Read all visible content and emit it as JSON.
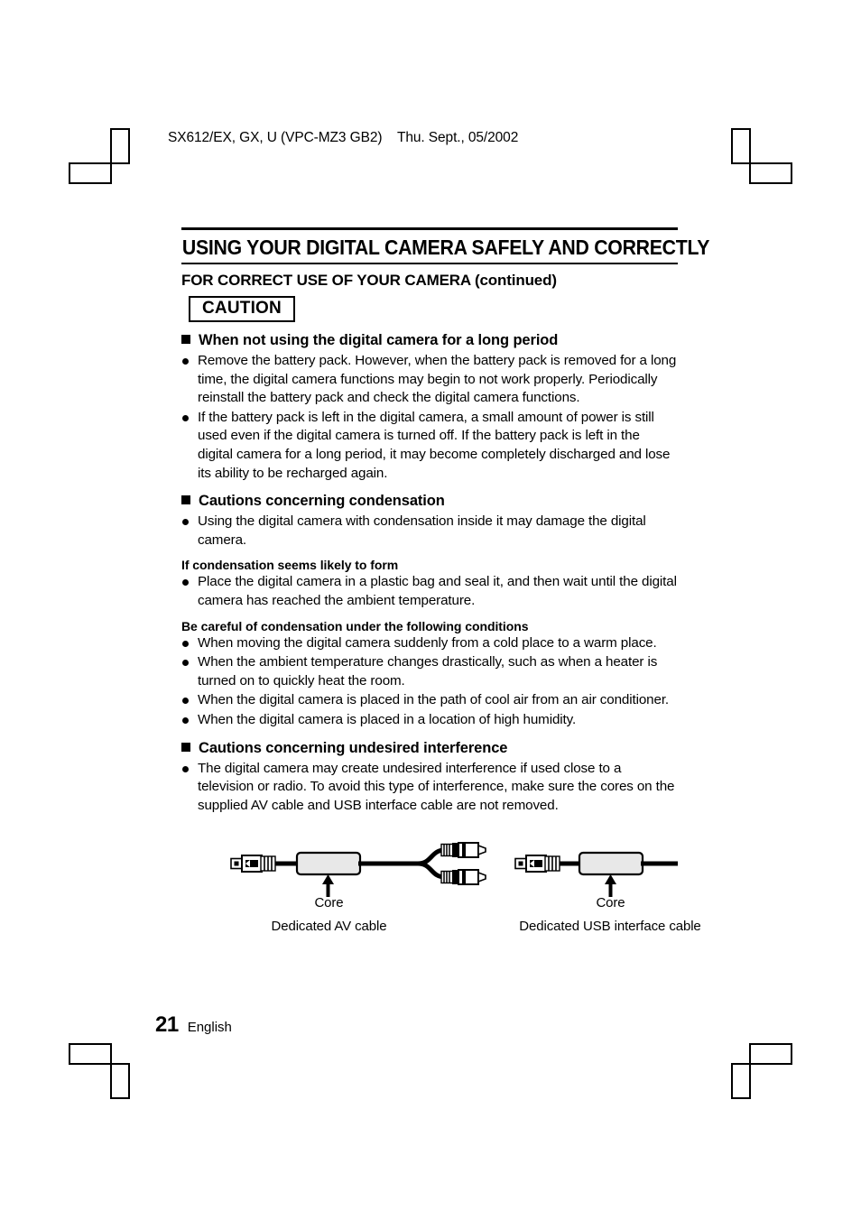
{
  "running_head": "SX612/EX, GX, U (VPC-MZ3 GB2)    Thu. Sept., 05/2002",
  "title": "USING YOUR DIGITAL CAMERA SAFELY AND CORRECTLY",
  "subtitle": "FOR CORRECT USE OF YOUR CAMERA (continued)",
  "caution_label": "CAUTION",
  "sections": [
    {
      "heading": "When not using the digital camera for a long period",
      "bullets": [
        "Remove the battery pack. However, when the battery pack is removed for a long time, the digital camera functions may begin to not work properly. Periodically reinstall the battery pack and check the digital camera functions.",
        "If the battery pack is left in the digital camera, a small amount of power is still used even if the digital camera is turned off. If the battery pack is left in the digital camera for a long period, it may become completely discharged and lose its ability to be recharged again."
      ]
    },
    {
      "heading": "Cautions concerning condensation",
      "bullets": [
        "Using the digital camera with condensation inside it may damage the digital camera."
      ],
      "sub_a_title": "If condensation seems likely to form",
      "sub_a_bullets": [
        "Place the digital camera in a plastic bag and seal it, and then wait until the digital camera has reached the ambient temperature."
      ],
      "sub_b_title": "Be careful of condensation under the following conditions",
      "sub_b_bullets": [
        "When moving the digital camera suddenly from a cold place to a warm place.",
        "When the ambient temperature changes drastically, such as when a heater is turned on to quickly heat the room.",
        "When the digital camera is placed in the path of cool air from an air conditioner.",
        "When the digital camera is placed in a location of high humidity."
      ]
    },
    {
      "heading": "Cautions concerning undesired interference",
      "bullets": [
        "The digital camera may create undesired interference if used close to a television or radio. To avoid this type of interference, make sure the cores on the supplied AV cable and USB interface cable are not removed."
      ]
    }
  ],
  "figure": {
    "av_core_label": "Core",
    "usb_core_label": "Core",
    "av_caption": "Dedicated AV cable",
    "usb_caption": "Dedicated USB interface cable"
  },
  "footer": {
    "page_number": "21",
    "language": "English"
  },
  "colors": {
    "ink": "#000000",
    "paper": "#ffffff",
    "core_fill": "#e8e8e8",
    "metal_fill": "#f2f2f2"
  }
}
